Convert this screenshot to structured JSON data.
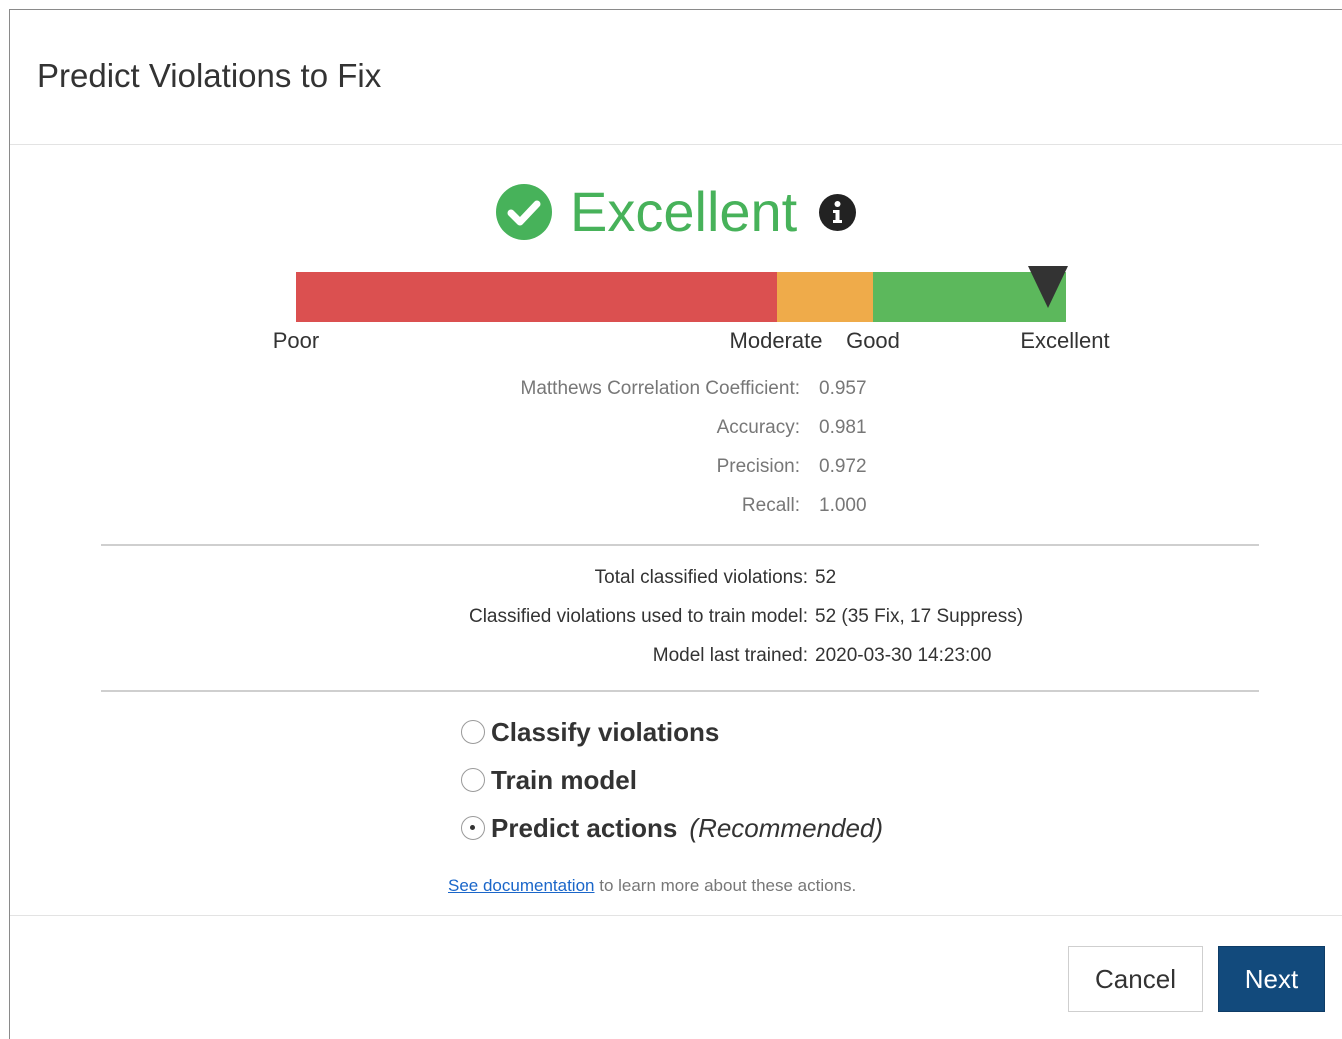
{
  "dialog": {
    "title": "Predict Violations to Fix"
  },
  "rating": {
    "text": "Excellent",
    "color": "#47b25a",
    "icon": "check-circle-icon",
    "info_icon": "info-icon"
  },
  "scale": {
    "labels": {
      "poor": "Poor",
      "moderate": "Moderate",
      "good": "Good",
      "excellent": "Excellent"
    },
    "colors": {
      "poor": "#db5050",
      "moderate": "#efab4a",
      "good": "#5cb85c"
    },
    "marker_position": "Excellent"
  },
  "metrics": [
    {
      "label": "Matthews Correlation Coefficient:",
      "value": "0.957"
    },
    {
      "label": "Accuracy:",
      "value": "0.981"
    },
    {
      "label": "Precision:",
      "value": "0.972"
    },
    {
      "label": "Recall:",
      "value": "1.000"
    }
  ],
  "stats": [
    {
      "label": "Total classified violations:",
      "value": "52"
    },
    {
      "label": "Classified violations used to train model:",
      "value": "52 (35 Fix, 17 Suppress)"
    },
    {
      "label": "Model last trained:",
      "value": "2020-03-30 14:23:00"
    }
  ],
  "actions": {
    "options": [
      {
        "label": "Classify violations",
        "note": "",
        "selected": false
      },
      {
        "label": "Train model",
        "note": "",
        "selected": false
      },
      {
        "label": "Predict actions",
        "note": "(Recommended)",
        "selected": true
      }
    ]
  },
  "documentation": {
    "link_text": "See documentation",
    "rest_text": " to learn more about these actions."
  },
  "buttons": {
    "cancel": "Cancel",
    "next": "Next",
    "next_color": "#124a7c"
  }
}
